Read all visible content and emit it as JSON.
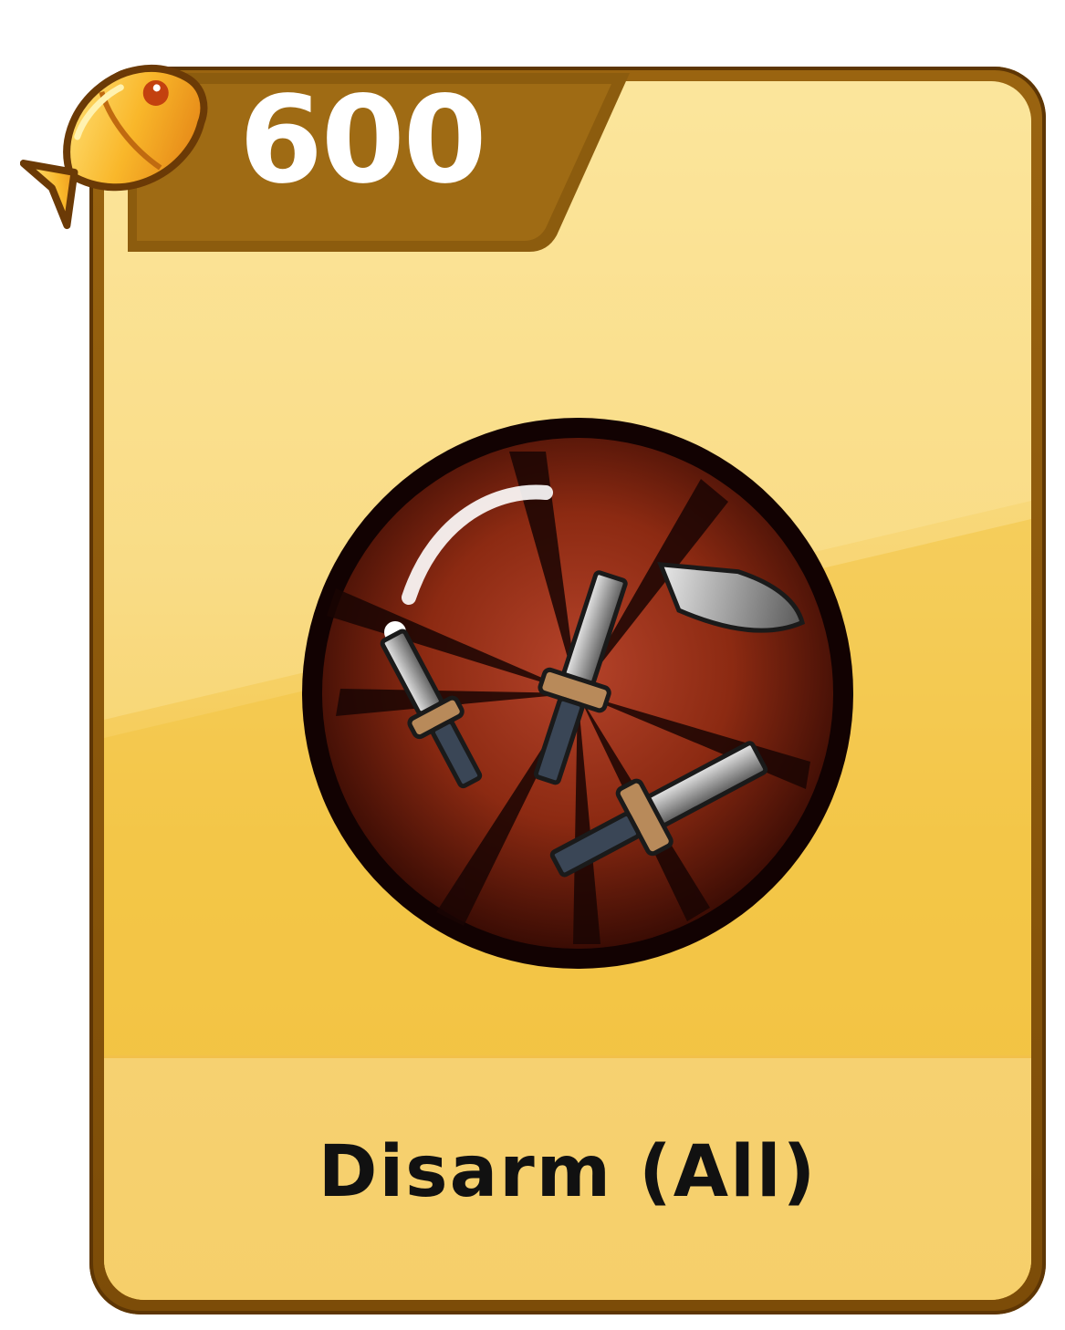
{
  "card": {
    "cost": "600",
    "currency_icon": "golden-fish-icon",
    "item_icon": "disarm-daggers-orb-icon",
    "title": "Disarm (All)"
  },
  "colors": {
    "frame": "#8a5a0c",
    "panel_light": "#fbe497",
    "panel_gold": "#f1bf3c",
    "orb_red": "#8c2a12",
    "text_dark": "#111111",
    "cost_text": "#ffffff"
  }
}
